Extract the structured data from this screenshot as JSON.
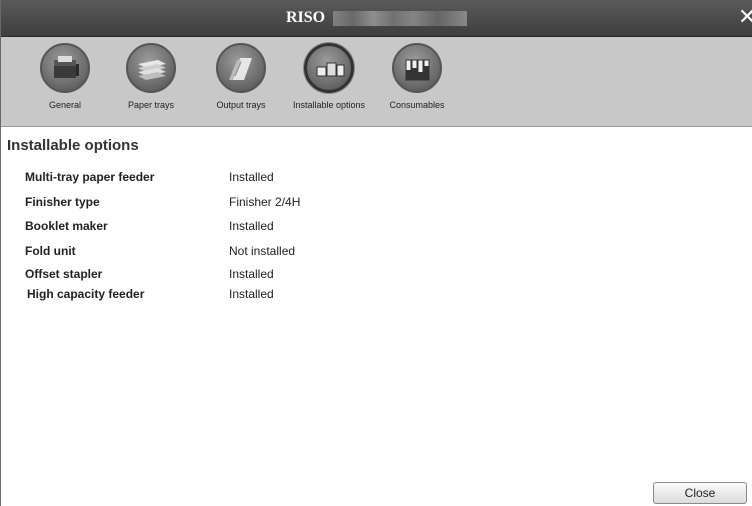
{
  "window": {
    "title": "RISO",
    "title_redacted": true
  },
  "toolbar": {
    "items": [
      {
        "label": "General",
        "icon": "printer-icon"
      },
      {
        "label": "Paper trays",
        "icon": "paper-stack-icon"
      },
      {
        "label": "Output trays",
        "icon": "output-paper-icon"
      },
      {
        "label": "Installable options",
        "icon": "printer-options-icon",
        "active": true
      },
      {
        "label": "Consumables",
        "icon": "ink-cartridges-icon"
      }
    ]
  },
  "main": {
    "section_title": "Installable options",
    "options": [
      {
        "name": "Multi-tray paper feeder",
        "value": "Installed"
      },
      {
        "name": "Finisher type",
        "value": "Finisher 2/4H"
      },
      {
        "name": "Booklet maker",
        "value": "Installed"
      },
      {
        "name": "Fold unit",
        "value": "Not installed"
      },
      {
        "name": "Offset stapler",
        "value": "Installed"
      },
      {
        "name": "High capacity feeder",
        "value": "Installed"
      }
    ]
  },
  "footer": {
    "close_label": "Close"
  },
  "colors": {
    "titlebar": "#474747",
    "toolbar": "#c8c8c8",
    "icon_circle": "#7a7a7a"
  }
}
